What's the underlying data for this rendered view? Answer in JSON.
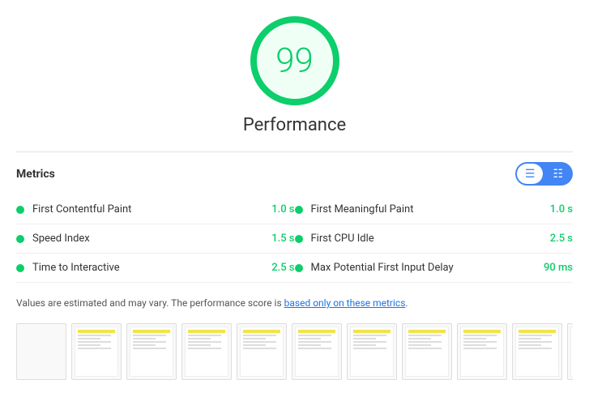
{
  "score": {
    "value": "99",
    "label": "Performance"
  },
  "metrics_section": {
    "title": "Metrics",
    "toggle": {
      "list_label": "≡",
      "grid_label": "⊟"
    }
  },
  "metrics": [
    {
      "name": "First Contentful Paint",
      "value": "1.0 s",
      "color": "#0cce6b"
    },
    {
      "name": "First Meaningful Paint",
      "value": "1.0 s",
      "color": "#0cce6b"
    },
    {
      "name": "Speed Index",
      "value": "1.5 s",
      "color": "#0cce6b"
    },
    {
      "name": "First CPU Idle",
      "value": "2.5 s",
      "color": "#0cce6b"
    },
    {
      "name": "Time to Interactive",
      "value": "2.5 s",
      "color": "#0cce6b"
    },
    {
      "name": "Max Potential First Input Delay",
      "value": "90 ms",
      "color": "#0cce6b"
    }
  ],
  "note": {
    "text": "Values are estimated and may vary. The performance score is ",
    "link_text": "based only on these metrics",
    "suffix": "."
  },
  "filmstrip": {
    "count": 10
  }
}
